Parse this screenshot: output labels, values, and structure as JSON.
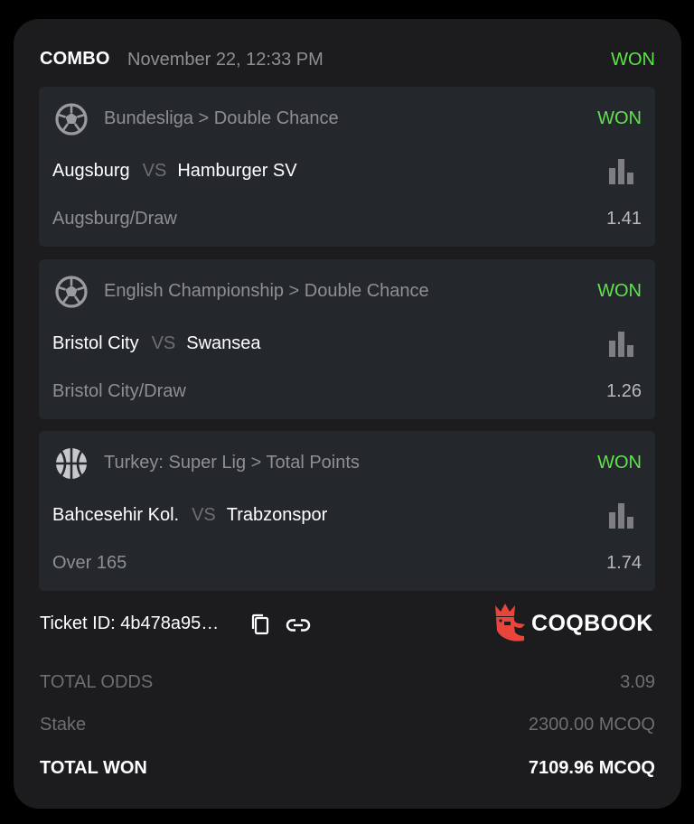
{
  "header": {
    "type": "COMBO",
    "date": "November 22, 12:33 PM",
    "status": "WON"
  },
  "bets": [
    {
      "sport_icon": "soccer-ball-icon",
      "league": "Bundesliga > Double Chance",
      "status": "WON",
      "home": "Augsburg",
      "vs": "VS",
      "away": "Hamburger SV",
      "pick": "Augsburg/Draw",
      "odds": "1.41"
    },
    {
      "sport_icon": "soccer-ball-icon",
      "league": "English Championship > Double Chance",
      "status": "WON",
      "home": "Bristol City",
      "vs": "VS",
      "away": "Swansea",
      "pick": "Bristol City/Draw",
      "odds": "1.26"
    },
    {
      "sport_icon": "basketball-icon",
      "league": "Turkey: Super Lig > Total Points",
      "status": "WON",
      "home": "Bahcesehir Kol.",
      "vs": "VS",
      "away": "Trabzonspor",
      "pick": "Over 165",
      "odds": "1.74"
    }
  ],
  "ticket": {
    "label": "Ticket ID: 4b478a95…",
    "copy_icon": "copy-icon",
    "link_icon": "link-icon"
  },
  "brand": {
    "name": "COQBOOK",
    "logo_color": "#e8453c"
  },
  "totals": {
    "total_odds_label": "TOTAL ODDS",
    "total_odds_value": "3.09",
    "stake_label": "Stake",
    "stake_value": "2300.00 MCOQ",
    "total_won_label": "TOTAL WON",
    "total_won_value": "7109.96 MCOQ"
  },
  "colors": {
    "won": "#5fe34b",
    "card_bg": "#1c1c1e",
    "bet_bg": "#24282d",
    "muted": "#8e8e93"
  }
}
